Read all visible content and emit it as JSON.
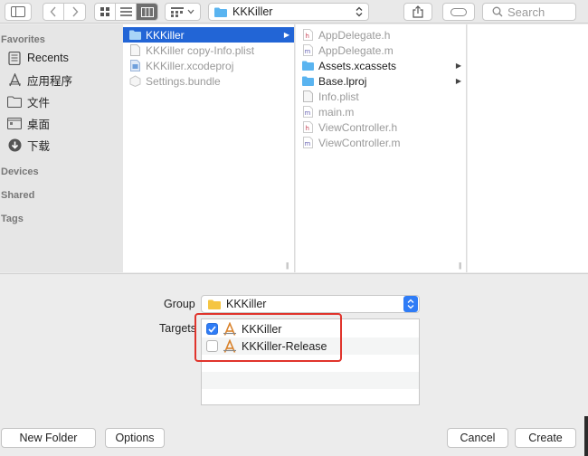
{
  "toolbar": {
    "path_label": "KKKiller",
    "search_placeholder": "Search"
  },
  "sidebar": {
    "sections": {
      "favorites": "Favorites",
      "devices": "Devices",
      "shared": "Shared",
      "tags": "Tags"
    },
    "items": [
      {
        "label": "Recents",
        "icon": "recents-icon"
      },
      {
        "label": "应用程序",
        "icon": "applications-icon"
      },
      {
        "label": "文件",
        "icon": "folder-icon"
      },
      {
        "label": "桌面",
        "icon": "desktop-icon"
      },
      {
        "label": "下载",
        "icon": "downloads-icon"
      }
    ]
  },
  "column1": {
    "items": [
      {
        "label": "KKKiller",
        "icon": "folder-icon"
      },
      {
        "label": "KKKiller copy-Info.plist",
        "icon": "plist-file-icon"
      },
      {
        "label": "KKKiller.xcodeproj",
        "icon": "xcodeproj-icon"
      },
      {
        "label": "Settings.bundle",
        "icon": "bundle-icon"
      }
    ]
  },
  "column2": {
    "items": [
      {
        "label": "AppDelegate.h",
        "icon": "header-file-icon"
      },
      {
        "label": "AppDelegate.m",
        "icon": "source-file-icon"
      },
      {
        "label": "Assets.xcassets",
        "icon": "folder-icon"
      },
      {
        "label": "Base.lproj",
        "icon": "folder-icon"
      },
      {
        "label": "Info.plist",
        "icon": "plist-file-icon"
      },
      {
        "label": "main.m",
        "icon": "source-file-icon"
      },
      {
        "label": "ViewController.h",
        "icon": "header-file-icon"
      },
      {
        "label": "ViewController.m",
        "icon": "source-file-icon"
      }
    ]
  },
  "panel": {
    "group_label": "Group",
    "group_value": "KKKiller",
    "targets_label": "Targets",
    "targets": [
      {
        "label": "KKKiller",
        "checked": true
      },
      {
        "label": "KKKiller-Release",
        "checked": false
      }
    ]
  },
  "buttons": {
    "new_folder": "New Folder",
    "options": "Options",
    "cancel": "Cancel",
    "create": "Create"
  },
  "colors": {
    "selection": "#2265d6",
    "accent": "#2f7cf6",
    "highlight_border": "#e0342c",
    "folder": "#5ab4f0"
  }
}
